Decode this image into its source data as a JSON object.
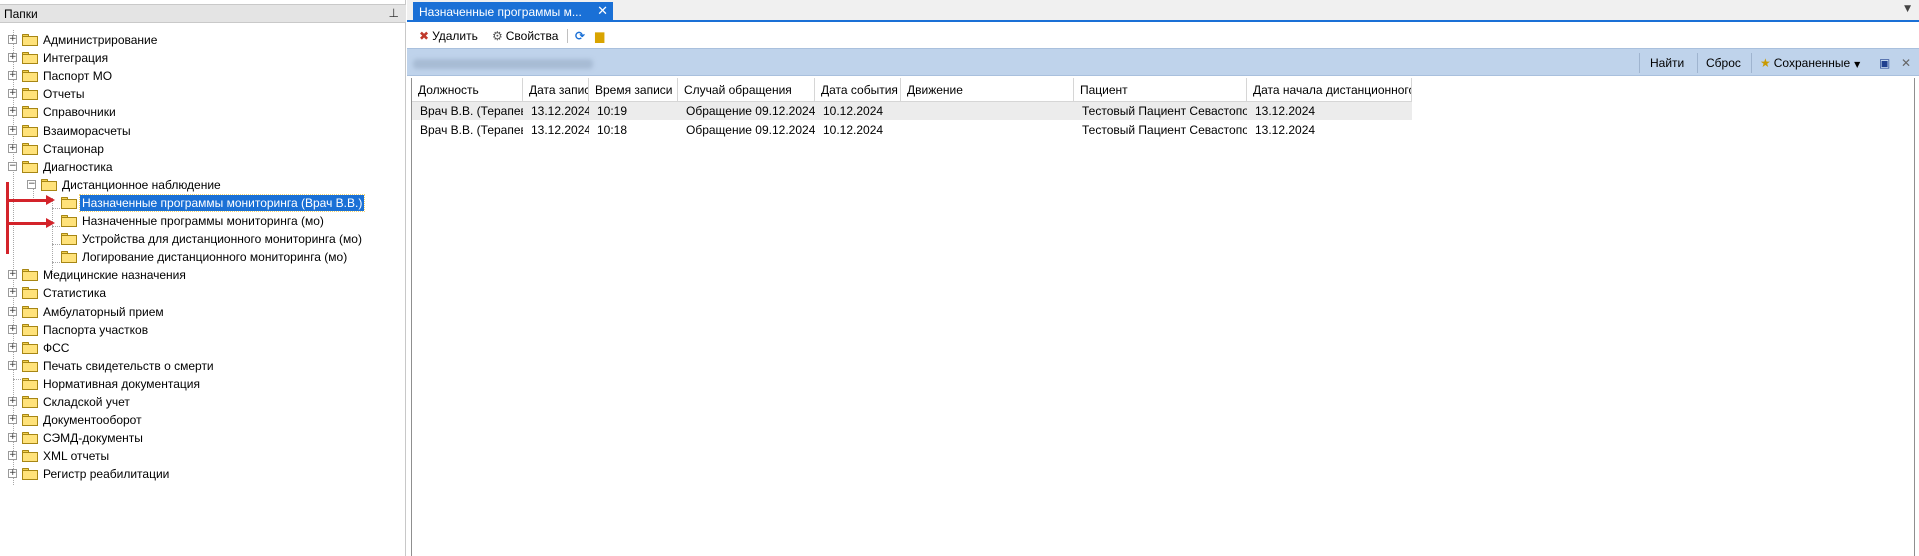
{
  "folders_panel": {
    "title": "Папки",
    "pin_icon": "pin-icon",
    "items": [
      {
        "label": "Администрирование",
        "expander": "+",
        "icon": "folder-icon"
      },
      {
        "label": "Интеграция",
        "expander": "+",
        "icon": "folder-icon"
      },
      {
        "label": "Паспорт МО",
        "expander": "+",
        "icon": "folder-icon"
      },
      {
        "label": "Отчеты",
        "expander": "+",
        "icon": "folder-icon"
      },
      {
        "label": "Справочники",
        "expander": "+",
        "icon": "folder-icon"
      },
      {
        "label": "Взаиморасчеты",
        "expander": "+",
        "icon": "folder-icon"
      },
      {
        "label": "Стационар",
        "expander": "+",
        "icon": "folder-icon"
      },
      {
        "label": "Диагностика",
        "expander": "−",
        "icon": "folder-icon"
      },
      {
        "label": "Дистанционное наблюдение",
        "expander": "−",
        "icon": "folder-icon"
      },
      {
        "label": "Назначенные программы мониторинга (Врач В.В.)",
        "expander": "",
        "icon": "folder-open-icon",
        "selected": true
      },
      {
        "label": "Назначенные программы мониторинга (мо)",
        "expander": "",
        "icon": "folder-icon"
      },
      {
        "label": "Устройства для дистанционного мониторинга (мо)",
        "expander": "",
        "icon": "folder-icon"
      },
      {
        "label": "Логирование дистанционного мониторинга (мо)",
        "expander": "",
        "icon": "folder-icon"
      },
      {
        "label": "Медицинские назначения",
        "expander": "+",
        "icon": "folder-icon"
      },
      {
        "label": "Статистика",
        "expander": "+",
        "icon": "folder-icon"
      },
      {
        "label": "Амбулаторный прием",
        "expander": "+",
        "icon": "folder-icon"
      },
      {
        "label": "Паспорта участков",
        "expander": "+",
        "icon": "folder-icon"
      },
      {
        "label": "ФСС",
        "expander": "+",
        "icon": "folder-icon"
      },
      {
        "label": "Печать свидетельств о смерти",
        "expander": "+",
        "icon": "folder-icon"
      },
      {
        "label": "Нормативная документация",
        "expander": "",
        "icon": "folder-icon"
      },
      {
        "label": "Складской учет",
        "expander": "+",
        "icon": "folder-icon"
      },
      {
        "label": "Документооборот",
        "expander": "+",
        "icon": "folder-icon"
      },
      {
        "label": "СЭМД-документы",
        "expander": "+",
        "icon": "folder-icon"
      },
      {
        "label": "XML отчеты",
        "expander": "+",
        "icon": "folder-icon"
      },
      {
        "label": "Регистр реабилитации",
        "expander": "+",
        "icon": "folder-icon"
      }
    ]
  },
  "document_tab": {
    "label": "Назначенные программы м...",
    "close_icon": "close-icon",
    "menu_icon": "chevron-down-icon"
  },
  "toolbar": {
    "delete_label": "Удалить",
    "delete_icon": "delete-icon",
    "properties_label": "Свойства",
    "properties_icon": "properties-icon",
    "refresh_icon": "refresh-icon",
    "folder_up_icon": "folder-up-icon"
  },
  "filterbar": {
    "find_label": "Найти",
    "reset_label": "Сброс",
    "saved_label": "Сохраненные",
    "saved_icon": "saved-filters-icon",
    "save_icon": "save-icon",
    "close_icon": "close-icon"
  },
  "grid": {
    "columns": [
      "Должность",
      "Дата записи",
      "Время записи",
      "Случай обращения",
      "Дата события",
      "Движение",
      "Пациент",
      "Дата начала дистанционного мо..."
    ],
    "rows": [
      [
        "Врач В.В. (Терапевт)",
        "13.12.2024",
        "10:19",
        "Обращение 09.12.2024 -",
        "10.12.2024",
        "",
        "Тестовый Пациент Севастополь",
        "13.12.2024"
      ],
      [
        "Врач В.В. (Терапевт)",
        "13.12.2024",
        "10:18",
        "Обращение 09.12.2024 -",
        "10.12.2024",
        "",
        "Тестовый Пациент Севастополь",
        "13.12.2024"
      ]
    ]
  },
  "colors": {
    "accent": "#1a70d6",
    "filter_bar": "#bfd3eb",
    "annotation_arrow": "#d3232a",
    "folder": "#ffe27a"
  }
}
